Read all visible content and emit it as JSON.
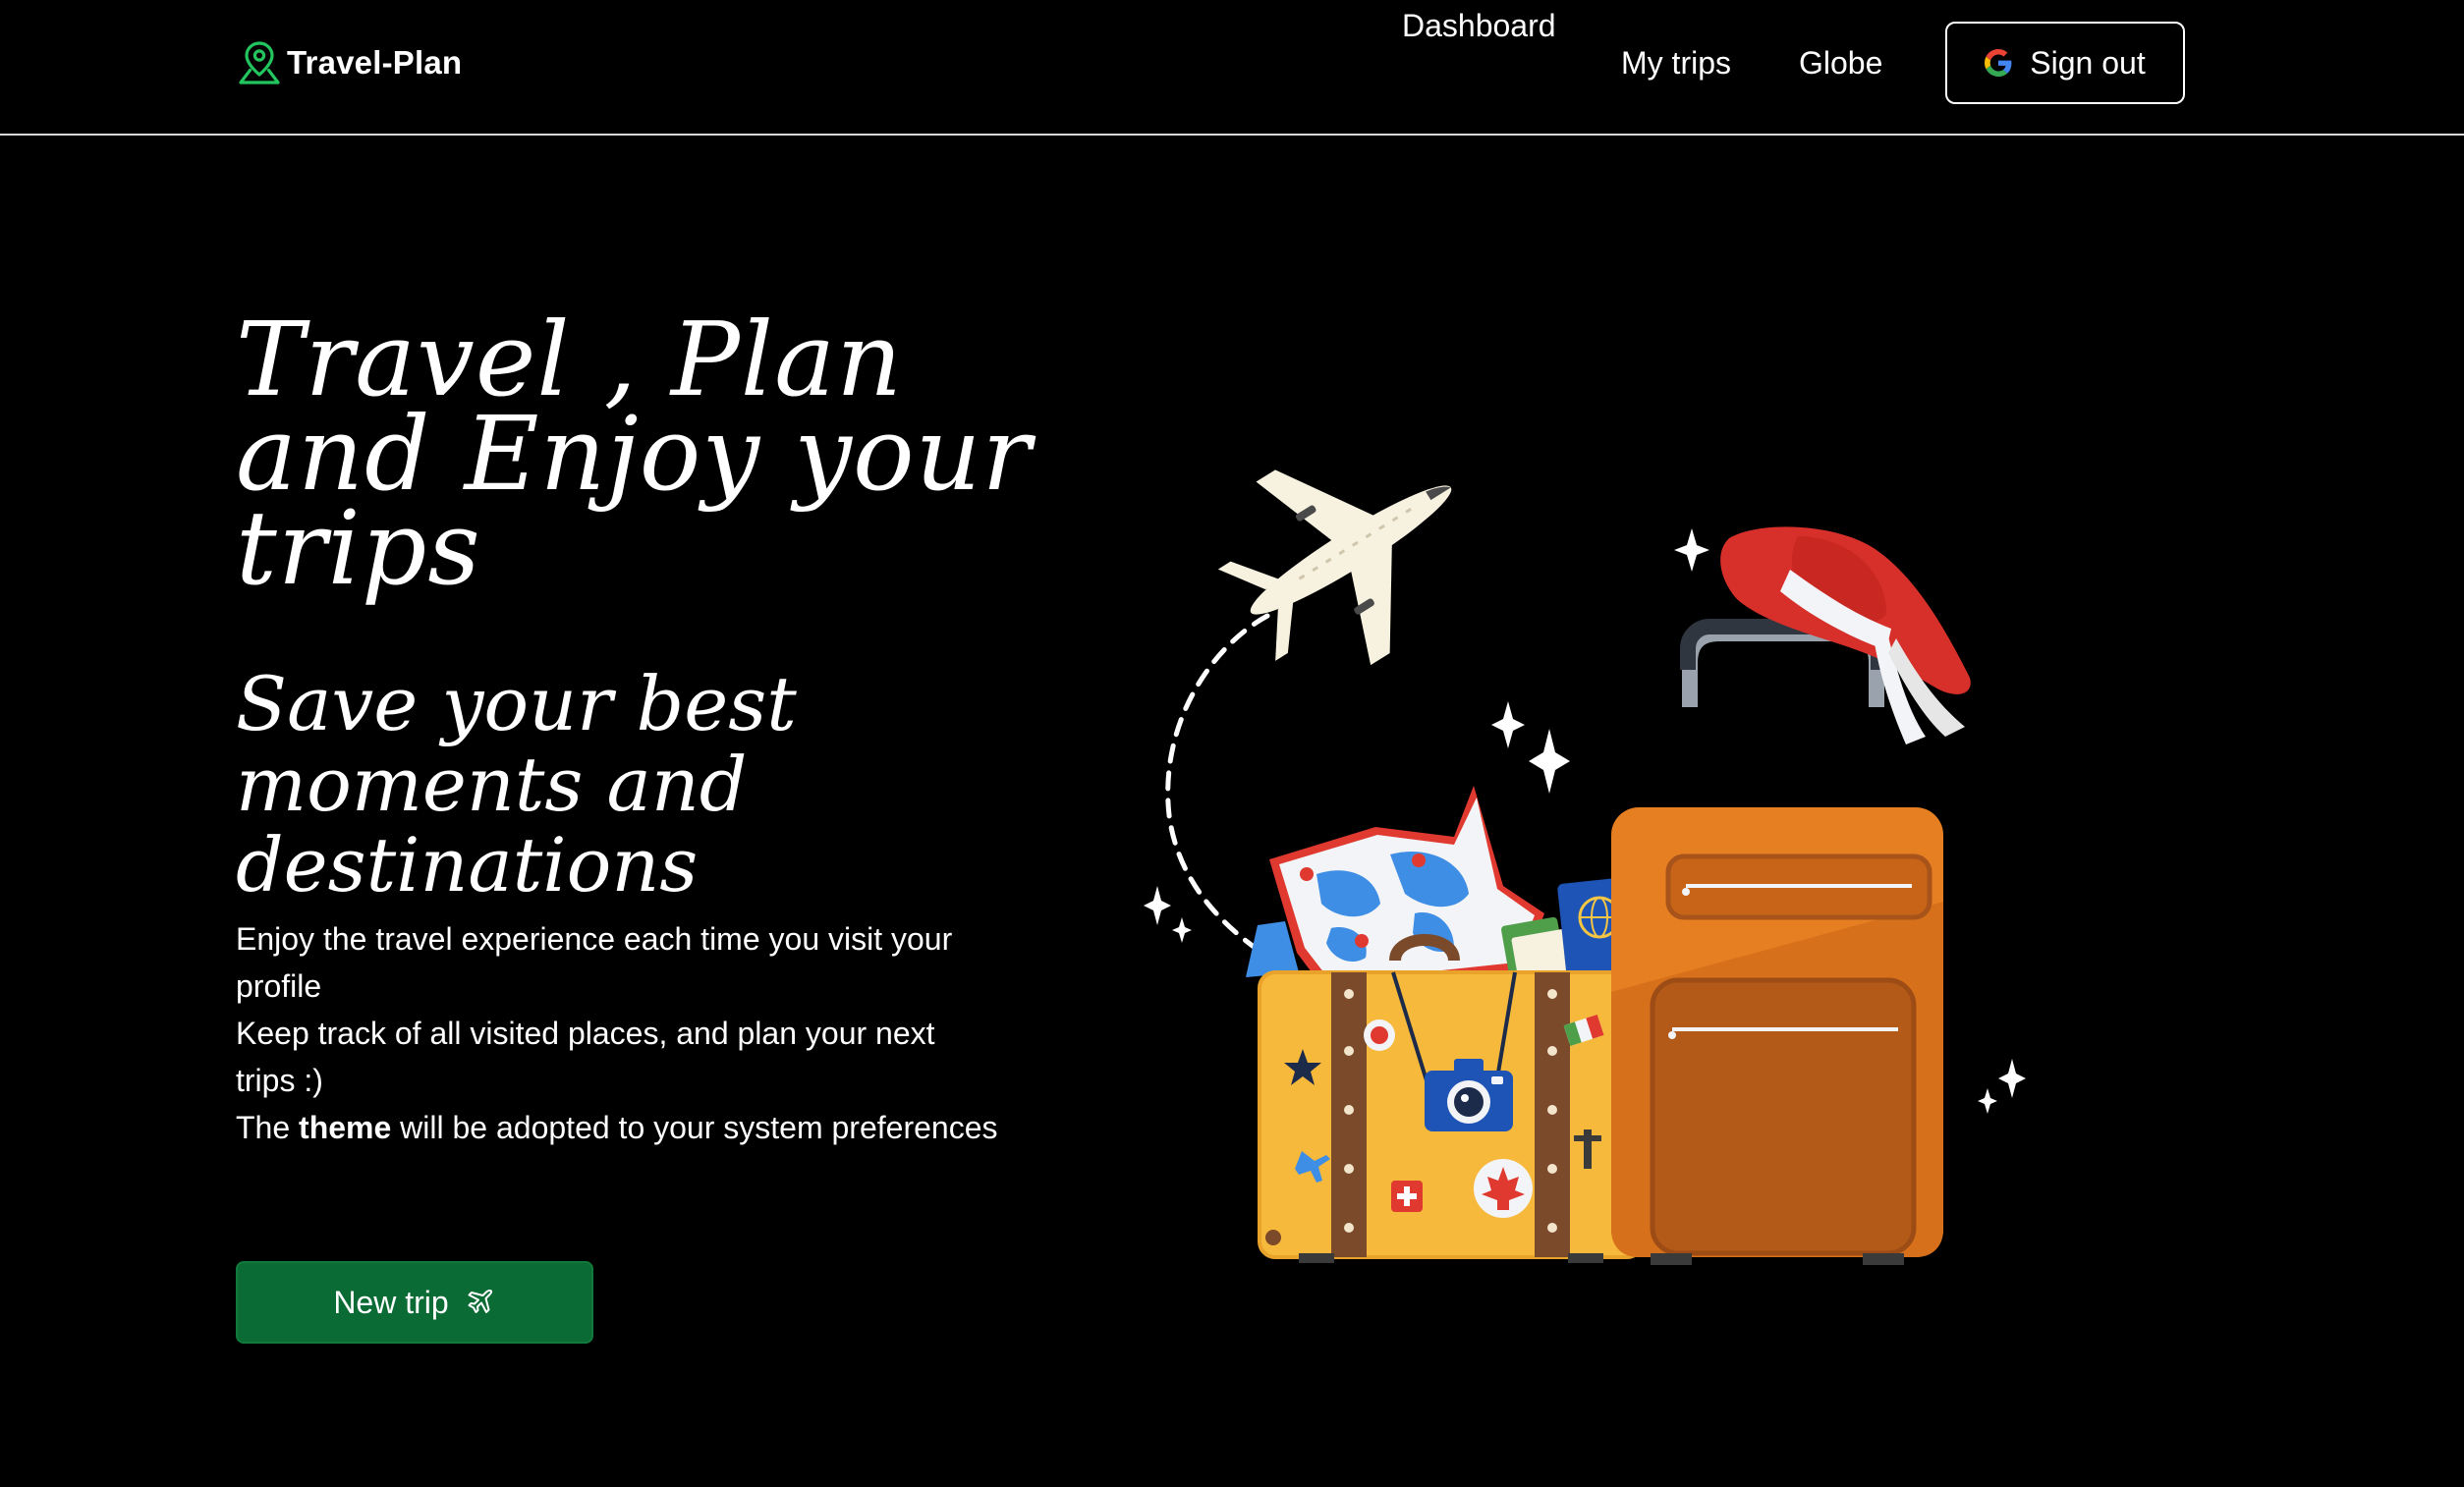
{
  "navbar": {
    "brand": "Travel-Plan",
    "links": [
      {
        "label": "Dashboard"
      },
      {
        "label": "My trips"
      },
      {
        "label": "Globe"
      }
    ],
    "signout_label": "Sign out"
  },
  "hero": {
    "title": "Travel , Plan and Enjoy your trips",
    "subtitle": "Save your best moments and destinations",
    "desc_line1": "Enjoy the travel experience each time you visit your profile",
    "desc_line2": "Keep track of all visited places, and plan your next trips :)",
    "desc_line3_prefix": "The ",
    "desc_line3_bold": "theme",
    "desc_line3_suffix": " will be adopted to your system preferences",
    "cta_label": "New trip"
  },
  "icons": {
    "brand": "map-pin-person-icon",
    "signout": "google-icon",
    "cta": "airplane-icon"
  },
  "colors": {
    "background": "#000000",
    "text": "#ffffff",
    "brand_icon": "#22c55e",
    "cta_background": "#0b6b34",
    "nav_border": "#d9d9d9"
  }
}
